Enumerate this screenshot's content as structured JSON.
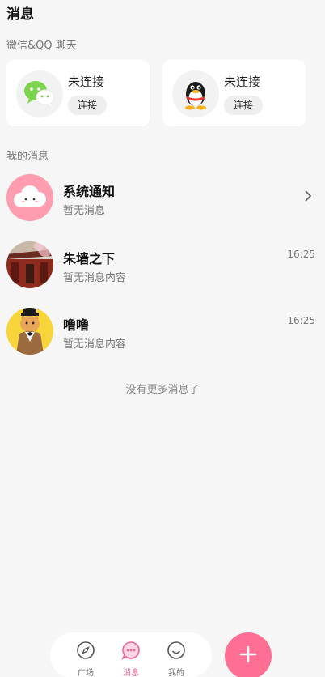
{
  "header": {
    "title": "消息"
  },
  "accounts": {
    "section_label": "微信&QQ 聊天",
    "cards": [
      {
        "service": "wechat",
        "icon": "wechat-icon",
        "status": "未连接",
        "button": "连接"
      },
      {
        "service": "qq",
        "icon": "qq-icon",
        "status": "未连接",
        "button": "连接"
      }
    ]
  },
  "messages": {
    "section_label": "我的消息",
    "items": [
      {
        "name": "系统通知",
        "preview": "暂无消息",
        "time": "",
        "avatar": "cloud-avatar-icon"
      },
      {
        "name": "朱墙之下",
        "preview": "暂无消息内容",
        "time": "16:25",
        "avatar": "red-wall-avatar"
      },
      {
        "name": "噜噜",
        "preview": "暂无消息内容",
        "time": "16:25",
        "avatar": "cat-avatar"
      }
    ],
    "end_note": "没有更多消息了"
  },
  "tabbar": {
    "tabs": [
      {
        "label": "广场",
        "icon": "compass-icon",
        "active": false
      },
      {
        "label": "消息",
        "icon": "chat-bubble-icon",
        "active": true
      },
      {
        "label": "我的",
        "icon": "smile-icon",
        "active": false
      }
    ],
    "fab_icon": "plus-icon"
  },
  "colors": {
    "accent": "#ff6f93",
    "background": "#f6f6f6"
  }
}
